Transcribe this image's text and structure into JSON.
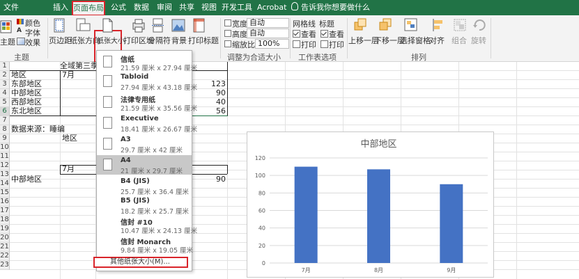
{
  "tabs": [
    "文件",
    "插入",
    "页面布局",
    "公式",
    "数据",
    "审阅",
    "共享",
    "视图",
    "开发工具",
    "Acrobat"
  ],
  "active_tab": "页面布局",
  "tell_me": "告诉我你想要做什么",
  "ribbon": {
    "themes": {
      "main_label": "主题",
      "colors": "颜色",
      "fonts": "字体",
      "effects": "效果",
      "group_label": "主题"
    },
    "page_setup": {
      "margins": "页边距",
      "orientation": "纸张方向",
      "size": "纸张大小",
      "print_area": "打印区域",
      "breaks": "分隔符",
      "background": "背景",
      "print_titles": "打印标题"
    },
    "scale": {
      "width_label": "宽度:",
      "width_value": "自动",
      "height_label": "高度:",
      "height_value": "自动",
      "scale_label": "缩放比例:",
      "scale_value": "100%",
      "group_label": "调整为合适大小"
    },
    "sheet_options": {
      "gridlines": "网格线",
      "headings": "标题",
      "view": "查看",
      "print": "打印",
      "group_label": "工作表选项"
    },
    "arrange": {
      "bring_forward": "上移一层",
      "send_backward": "下移一层",
      "selection_pane": "选择窗格",
      "align": "对齐",
      "group": "组合",
      "rotate": "旋转",
      "group_label": "排列"
    }
  },
  "rows": [
    "1",
    "2",
    "3",
    "4",
    "5",
    "6",
    "7",
    "8",
    "9",
    "10",
    "11",
    "12",
    "13",
    "14",
    "15",
    "16",
    "17",
    "18",
    "19",
    "20",
    "21",
    "22",
    "23"
  ],
  "cells": {
    "title": "全域第三季",
    "region_header": "地区",
    "month_header": "7月",
    "east": "东部地区",
    "central": "中部地区",
    "west": "西部地区",
    "northeast": "东北地区",
    "v_east": "123",
    "v_central": "90",
    "v_west": "40",
    "v_northeast": "56",
    "source": "数据来源：睡编",
    "region2": "地区",
    "month2": "7月",
    "central2": "中部地区",
    "v_central2": "90"
  },
  "paper_sizes": [
    {
      "name": "信纸",
      "size": "21.59 厘米 x 27.94 厘米"
    },
    {
      "name": "Tabloid",
      "size": "27.94 厘米 x 43.18 厘米"
    },
    {
      "name": "法律专用纸",
      "size": "21.59 厘米 x 35.56 厘米"
    },
    {
      "name": "Executive",
      "size": "18.41 厘米 x 26.67 厘米"
    },
    {
      "name": "A3",
      "size": "29.7 厘米 x 42 厘米"
    },
    {
      "name": "A4",
      "size": "21 厘米 x 29.7 厘米"
    },
    {
      "name": "B4 (JIS)",
      "size": "25.7 厘米 x 36.4 厘米"
    },
    {
      "name": "B5 (JIS)",
      "size": "18.2 厘米 x 25.7 厘米"
    },
    {
      "name": "信封 #10",
      "size": "10.47 厘米 x 24.13 厘米"
    },
    {
      "name": "信封 Monarch",
      "size": "9.84 厘米 x 19.05 厘米"
    }
  ],
  "selected_paper": "A4",
  "more_sizes": "其他纸张大小(M)...",
  "colors": {
    "excel_green": "#217346",
    "bar_blue": "#4472c4",
    "highlight_red": "#d9242a"
  },
  "chart_data": {
    "type": "bar",
    "title": "中部地区",
    "categories": [
      "7月",
      "8月",
      "9月"
    ],
    "values": [
      110,
      107,
      90
    ],
    "yticks": [
      "0",
      "20",
      "40",
      "60",
      "80",
      "100",
      "120"
    ],
    "ylim": [
      0,
      120
    ],
    "grid": true
  }
}
